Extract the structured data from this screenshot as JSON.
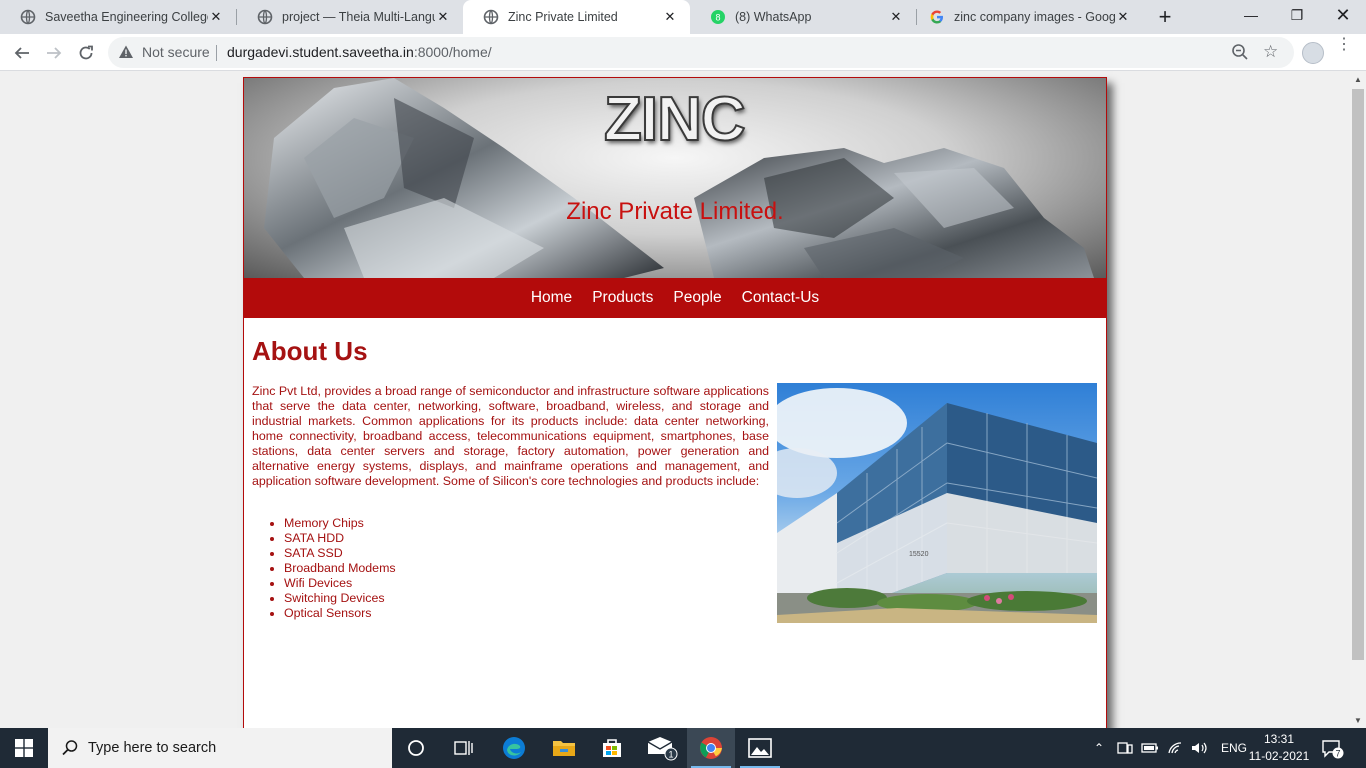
{
  "browser": {
    "tabs": [
      {
        "title": "Saveetha Engineering College",
        "active": false
      },
      {
        "title": "project — Theia Multi-Language",
        "active": false
      },
      {
        "title": "Zinc Private Limited",
        "active": true
      },
      {
        "title": "(8) WhatsApp",
        "active": false
      },
      {
        "title": "zinc company images - Google",
        "active": false
      }
    ],
    "whatsapp_badge": "8",
    "security_label": "Not secure",
    "url_host": "durgadevi.student.saveetha.in",
    "url_path": ":8000/home/"
  },
  "page": {
    "banner_logo": "ZINC",
    "banner_subtitle": "Zinc Private Limited.",
    "nav": [
      "Home",
      "Products",
      "People",
      "Contact-Us"
    ],
    "about_title": "About Us",
    "about_text": "Zinc Pvt Ltd, provides a broad range of semiconductor and infrastructure software applications that serve the data center, networking, software, broadband, wireless, and storage and industrial markets. Common applications for its products include: data center networking, home connectivity, broadband access, telecommunications equipment, smartphones, base stations, data center servers and storage, factory automation, power generation and alternative energy systems, displays, and mainframe operations and management, and application software development. Some of Silicon's core technologies and products include:",
    "products": [
      "Memory Chips",
      "SATA HDD",
      "SATA SSD",
      "Broadband Modems",
      "Wifi Devices",
      "Switching Devices",
      "Optical Sensors"
    ],
    "building_number": "15520"
  },
  "taskbar": {
    "search_placeholder": "Type here to search",
    "mail_badge": "1",
    "language": "ENG",
    "time": "13:31",
    "date": "11-02-2021",
    "notification_count": "7"
  },
  "colors": {
    "brand_red": "#b30b0b",
    "text_red": "#a51212",
    "taskbar_bg": "#1f2a36"
  }
}
